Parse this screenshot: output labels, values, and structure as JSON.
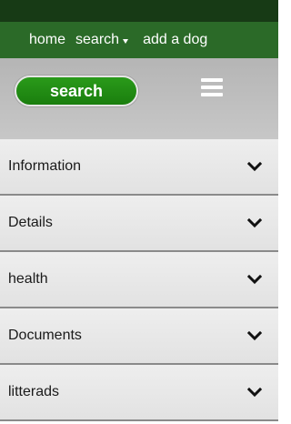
{
  "nav": {
    "home_label": "home",
    "search_label": "search",
    "add_dog_label": "add a dog"
  },
  "toolbar": {
    "search_button_label": "search",
    "menu_icon": "hamburger-menu-icon"
  },
  "sections": [
    {
      "label": "Information",
      "icon": "chevron-down-icon"
    },
    {
      "label": "Details",
      "icon": "chevron-down-icon"
    },
    {
      "label": "health",
      "icon": "chevron-down-icon"
    },
    {
      "label": "Documents",
      "icon": "chevron-down-icon"
    },
    {
      "label": "litterads",
      "icon": "chevron-down-icon"
    }
  ],
  "colors": {
    "topbar_dark": "#173a15",
    "navbar_green": "#2b6a28",
    "search_button_green": "#1a8a12",
    "toolbar_grey": "#bdbdbd",
    "accordion_bg": "#e6e6e6"
  }
}
